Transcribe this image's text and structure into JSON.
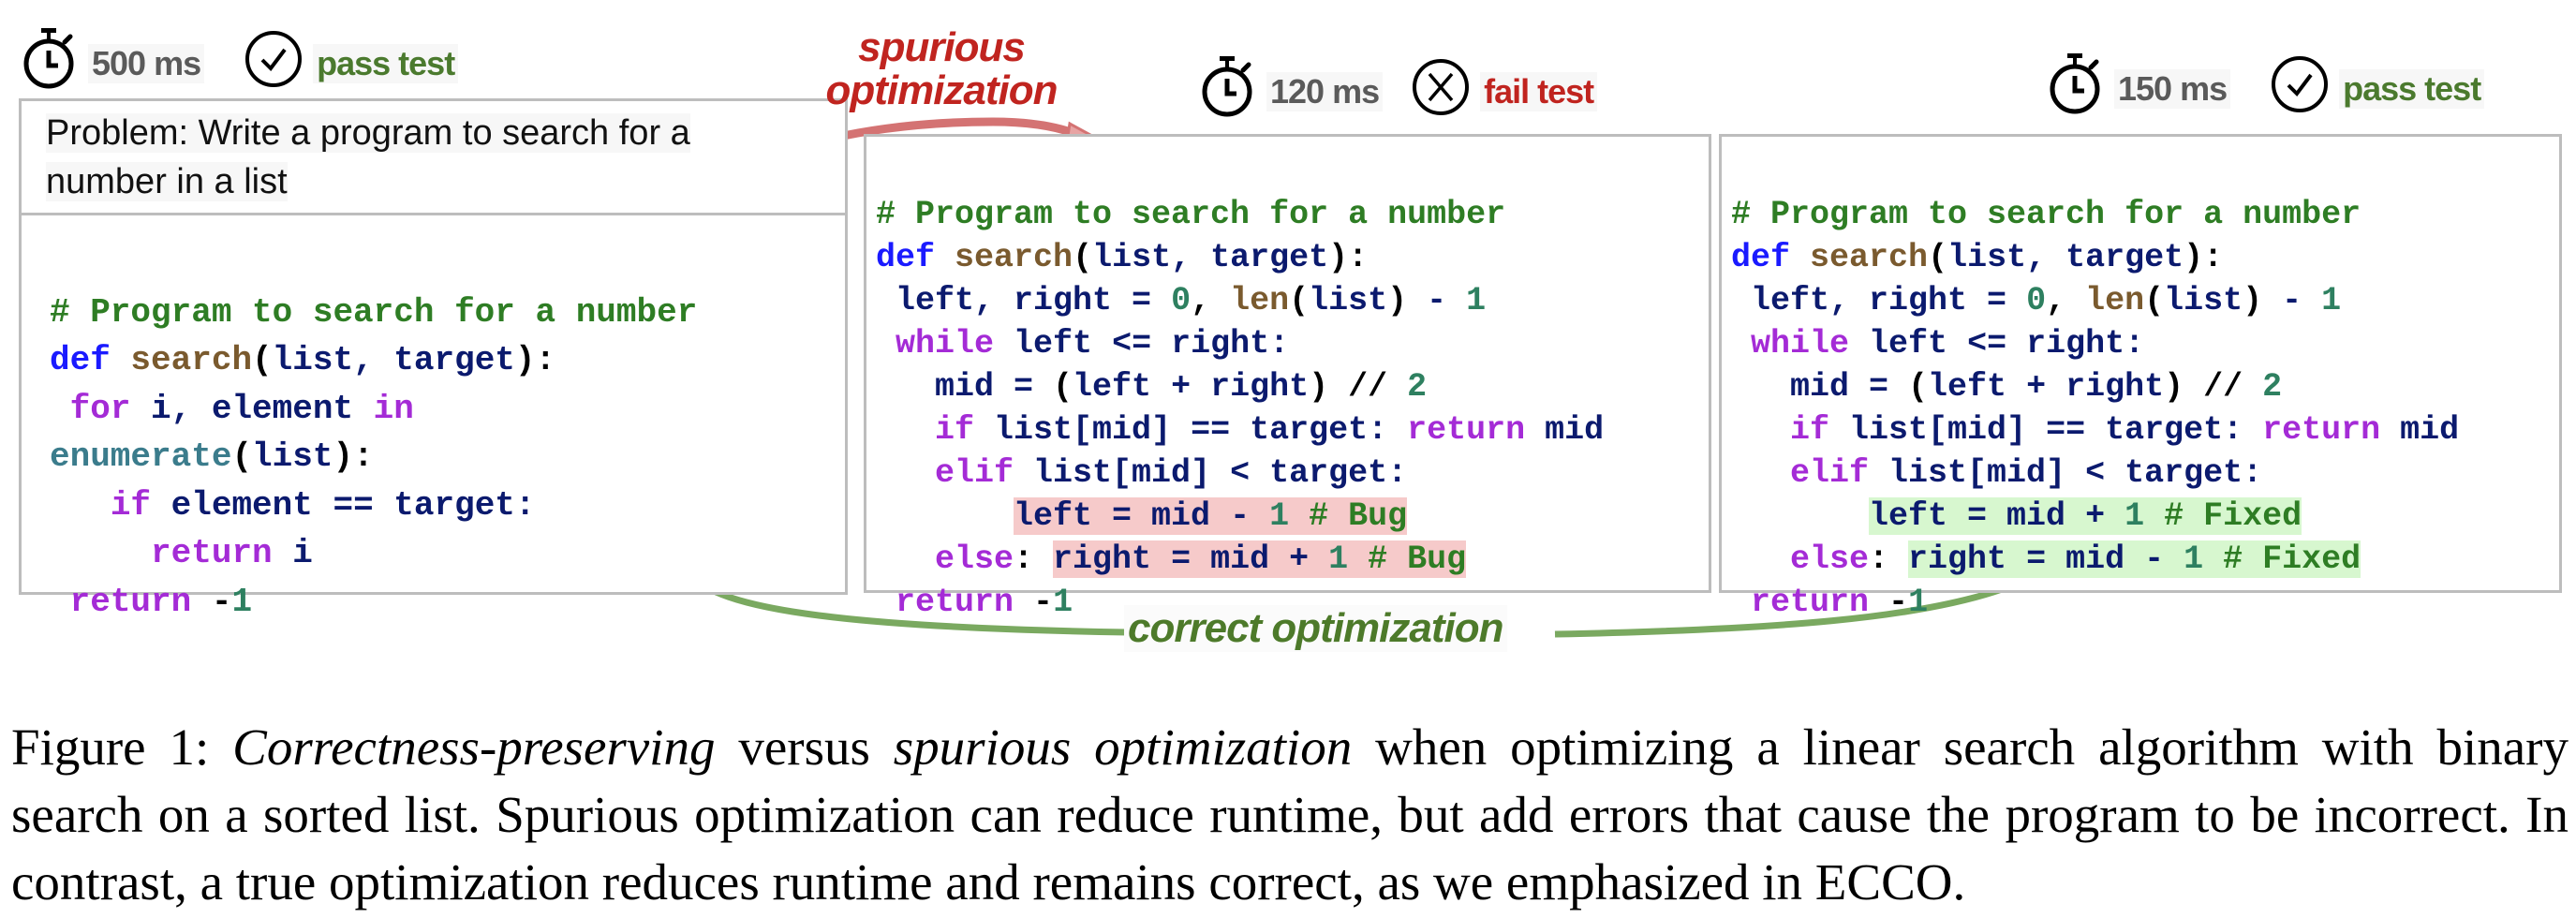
{
  "figure": {
    "colors": {
      "comment": "#2e7d24",
      "keyword_def": "#1a1aff",
      "function_name": "#7a5a2e",
      "control_keyword": "#a42bd6",
      "identifier": "#0b1a6e",
      "number": "#2e8060",
      "builtin": "#3b7c8c",
      "bug_highlight": "#f6caca",
      "fixed_highlight": "#d7f7cf",
      "spurious_red": "#c0241f",
      "correct_green": "#4d7a2a"
    },
    "original": {
      "runtime": "500 ms",
      "test_status": "pass test",
      "timer_icon": "stopwatch-icon",
      "status_icon": "check-circle-icon",
      "problem": "Problem: Write a program to search for a number in a list",
      "problem_line1": "Problem: Write a program to search for a",
      "problem_line2": "number in a list",
      "code": {
        "l1_comment": "# Program to search for a number",
        "l2_def": "def",
        "l2_fn": "search",
        "l2_open": "(",
        "l2_args": "list, target",
        "l2_close": ")",
        "l2_colon": ":",
        "l3_indent": " ",
        "l3_for": "for",
        "l3_vars": " i, element ",
        "l3_in": "in",
        "l4_enum": "enumerate",
        "l4_open": "(",
        "l4_arg": "list",
        "l4_close": ")",
        "l4_colon": ":",
        "l5_indent": "   ",
        "l5_if": "if",
        "l5_rest": " element == target:",
        "l6_indent": "     ",
        "l6_return": "return",
        "l6_rest": " i",
        "l7_indent": " ",
        "l7_return": "return",
        "l7_minus": " -",
        "l7_num": "1"
      }
    },
    "spurious": {
      "arrow_label_line1": "spurious",
      "arrow_label_line2": "optimization",
      "runtime": "120 ms",
      "test_status": "fail test",
      "timer_icon": "stopwatch-icon",
      "status_icon": "x-circle-icon",
      "code": {
        "comment": "# Program to search for a number",
        "def": "def",
        "fn": "search",
        "open": "(",
        "args": "list, target",
        "close": ")",
        "colon": ":",
        "l3_a": " left, right = ",
        "l3_zero": "0",
        "l3_comma": ", ",
        "l3_len": "len",
        "l3_open": "(",
        "l3_list": "list",
        "l3_close": ")",
        "l3_minus": " - ",
        "l3_one": "1",
        "l4_indent": " ",
        "l4_while": "while",
        "l4_rest": " left <= right:",
        "l5_a": "   mid = ",
        "l5_open": "(",
        "l5_mid": "left + right",
        "l5_close": ")",
        "l5_div": " // ",
        "l5_two": "2",
        "l6_indent": "   ",
        "l6_if": "if",
        "l6_mid": " list[mid] == target: ",
        "l6_return": "return",
        "l6_end": " mid",
        "l7_indent": "   ",
        "l7_elif": "elif",
        "l7_rest": " list[mid] < target:",
        "l8_indent": "       ",
        "l8_code": "left = mid - ",
        "l8_one": "1",
        "l8_comment": " # Bug",
        "l9_indent": "   ",
        "l9_else": "else",
        "l9_colon": ": ",
        "l9_code": "right = mid + ",
        "l9_one": "1",
        "l9_comment": " # Bug",
        "l10_indent": " ",
        "l10_return": "return",
        "l10_minus": " -",
        "l10_one": "1"
      }
    },
    "correct": {
      "arrow_label": "correct optimization",
      "runtime": "150 ms",
      "test_status": "pass test",
      "timer_icon": "stopwatch-icon",
      "status_icon": "check-circle-icon",
      "code": {
        "comment": "# Program to search for a number",
        "def": "def",
        "fn": "search",
        "open": "(",
        "args": "list, target",
        "close": ")",
        "colon": ":",
        "l3_a": " left, right = ",
        "l3_zero": "0",
        "l3_comma": ", ",
        "l3_len": "len",
        "l3_open": "(",
        "l3_list": "list",
        "l3_close": ")",
        "l3_minus": " - ",
        "l3_one": "1",
        "l4_indent": " ",
        "l4_while": "while",
        "l4_rest": " left <= right:",
        "l5_a": "   mid = ",
        "l5_open": "(",
        "l5_mid": "left + right",
        "l5_close": ")",
        "l5_div": " // ",
        "l5_two": "2",
        "l6_indent": "   ",
        "l6_if": "if",
        "l6_mid": " list[mid] == target: ",
        "l6_return": "return",
        "l6_end": " mid",
        "l7_indent": "   ",
        "l7_elif": "elif",
        "l7_rest": " list[mid] < target:",
        "l8_indent": "       ",
        "l8_code": "left = mid + ",
        "l8_one": "1",
        "l8_comment": " # Fixed",
        "l9_indent": "   ",
        "l9_else": "else",
        "l9_colon": ": ",
        "l9_code": "right = mid - ",
        "l9_one": "1",
        "l9_comment": " # Fixed",
        "l10_indent": " ",
        "l10_return": "return",
        "l10_minus": " -",
        "l10_one": "1"
      }
    }
  },
  "caption": {
    "prefix": "Figure 1: ",
    "italic1": "Correctness-preserving",
    "mid1": " versus ",
    "italic2": "spurious optimization",
    "rest": " when optimizing a linear search algorithm with binary search on a sorted list. Spurious optimization can reduce runtime, but add errors that cause the program to be incorrect. In contrast, a true optimization reduces runtime and remains correct, as we emphasized in ECCO."
  }
}
